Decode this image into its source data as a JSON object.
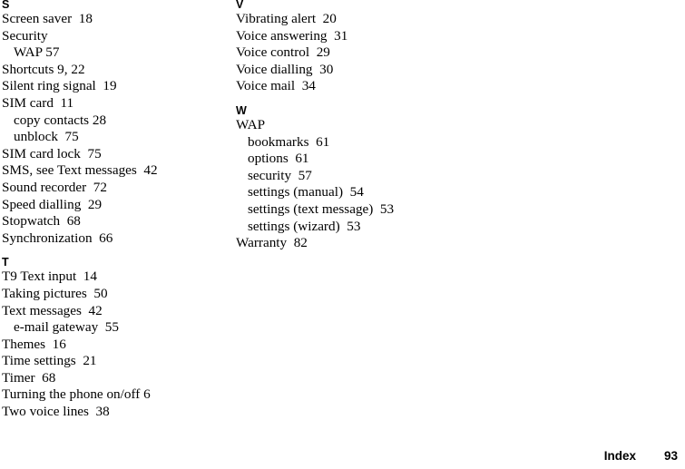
{
  "page": {
    "footer": {
      "label": "Index",
      "page_number": "93"
    },
    "text_color": "#000000",
    "background_color": "#ffffff"
  },
  "columns": [
    {
      "id": "left",
      "sections": [
        {
          "heading": "S",
          "entries": [
            {
              "label": "Screen saver",
              "page": "18",
              "level": 0,
              "text": "Screen saver  18"
            },
            {
              "label": "Security",
              "page": "",
              "level": 0,
              "text": "Security"
            },
            {
              "label": "WAP",
              "page": "57",
              "level": 1,
              "text": "WAP 57"
            },
            {
              "label": "Shortcuts",
              "page": "9, 22",
              "level": 0,
              "text": "Shortcuts 9, 22"
            },
            {
              "label": "Silent ring signal",
              "page": "19",
              "level": 0,
              "text": "Silent ring signal  19"
            },
            {
              "label": "SIM card",
              "page": "11",
              "level": 0,
              "text": "SIM card  11"
            },
            {
              "label": "copy contacts",
              "page": "28",
              "level": 1,
              "text": "copy contacts 28"
            },
            {
              "label": "unblock",
              "page": "75",
              "level": 1,
              "text": "unblock  75"
            },
            {
              "label": "SIM card lock",
              "page": "75",
              "level": 0,
              "text": "SIM card lock  75"
            },
            {
              "label": "SMS, see Text messages",
              "page": "42",
              "level": 0,
              "text": "SMS, see Text messages  42"
            },
            {
              "label": "Sound recorder",
              "page": "72",
              "level": 0,
              "text": "Sound recorder  72"
            },
            {
              "label": "Speed dialling",
              "page": "29",
              "level": 0,
              "text": "Speed dialling  29"
            },
            {
              "label": "Stopwatch",
              "page": "68",
              "level": 0,
              "text": "Stopwatch  68"
            },
            {
              "label": "Synchronization",
              "page": "66",
              "level": 0,
              "text": "Synchronization  66"
            }
          ]
        },
        {
          "heading": "T",
          "entries": [
            {
              "label": "T9 Text input",
              "page": "14",
              "level": 0,
              "text": "T9 Text input  14"
            },
            {
              "label": "Taking pictures",
              "page": "50",
              "level": 0,
              "text": "Taking pictures  50"
            },
            {
              "label": "Text messages",
              "page": "42",
              "level": 0,
              "text": "Text messages  42"
            },
            {
              "label": "e-mail gateway",
              "page": "55",
              "level": 1,
              "text": "e-mail gateway  55"
            },
            {
              "label": "Themes",
              "page": "16",
              "level": 0,
              "text": "Themes  16"
            },
            {
              "label": "Time settings",
              "page": "21",
              "level": 0,
              "text": "Time settings  21"
            },
            {
              "label": "Timer",
              "page": "68",
              "level": 0,
              "text": "Timer  68"
            },
            {
              "label": "Turning the phone on/off",
              "page": "6",
              "level": 0,
              "text": "Turning the phone on/off 6"
            },
            {
              "label": "Two voice lines",
              "page": "38",
              "level": 0,
              "text": "Two voice lines  38"
            }
          ]
        }
      ]
    },
    {
      "id": "right",
      "sections": [
        {
          "heading": "V",
          "entries": [
            {
              "label": "Vibrating alert",
              "page": "20",
              "level": 0,
              "text": "Vibrating alert  20"
            },
            {
              "label": "Voice answering",
              "page": "31",
              "level": 0,
              "text": "Voice answering  31"
            },
            {
              "label": "Voice control",
              "page": "29",
              "level": 0,
              "text": "Voice control  29"
            },
            {
              "label": "Voice dialling",
              "page": "30",
              "level": 0,
              "text": "Voice dialling  30"
            },
            {
              "label": "Voice mail",
              "page": "34",
              "level": 0,
              "text": "Voice mail  34"
            }
          ]
        },
        {
          "heading": "W",
          "entries": [
            {
              "label": "WAP",
              "page": "",
              "level": 0,
              "text": "WAP"
            },
            {
              "label": "bookmarks",
              "page": "61",
              "level": 1,
              "text": "bookmarks  61"
            },
            {
              "label": "options",
              "page": "61",
              "level": 1,
              "text": "options  61"
            },
            {
              "label": "security",
              "page": "57",
              "level": 1,
              "text": "security  57"
            },
            {
              "label": "settings (manual)",
              "page": "54",
              "level": 1,
              "text": "settings (manual)  54"
            },
            {
              "label": "settings (text message)",
              "page": "53",
              "level": 1,
              "text": "settings (text message)  53"
            },
            {
              "label": "settings (wizard)",
              "page": "53",
              "level": 1,
              "text": "settings (wizard)  53"
            },
            {
              "label": "Warranty",
              "page": "82",
              "level": 0,
              "text": "Warranty  82"
            }
          ]
        }
      ]
    }
  ]
}
